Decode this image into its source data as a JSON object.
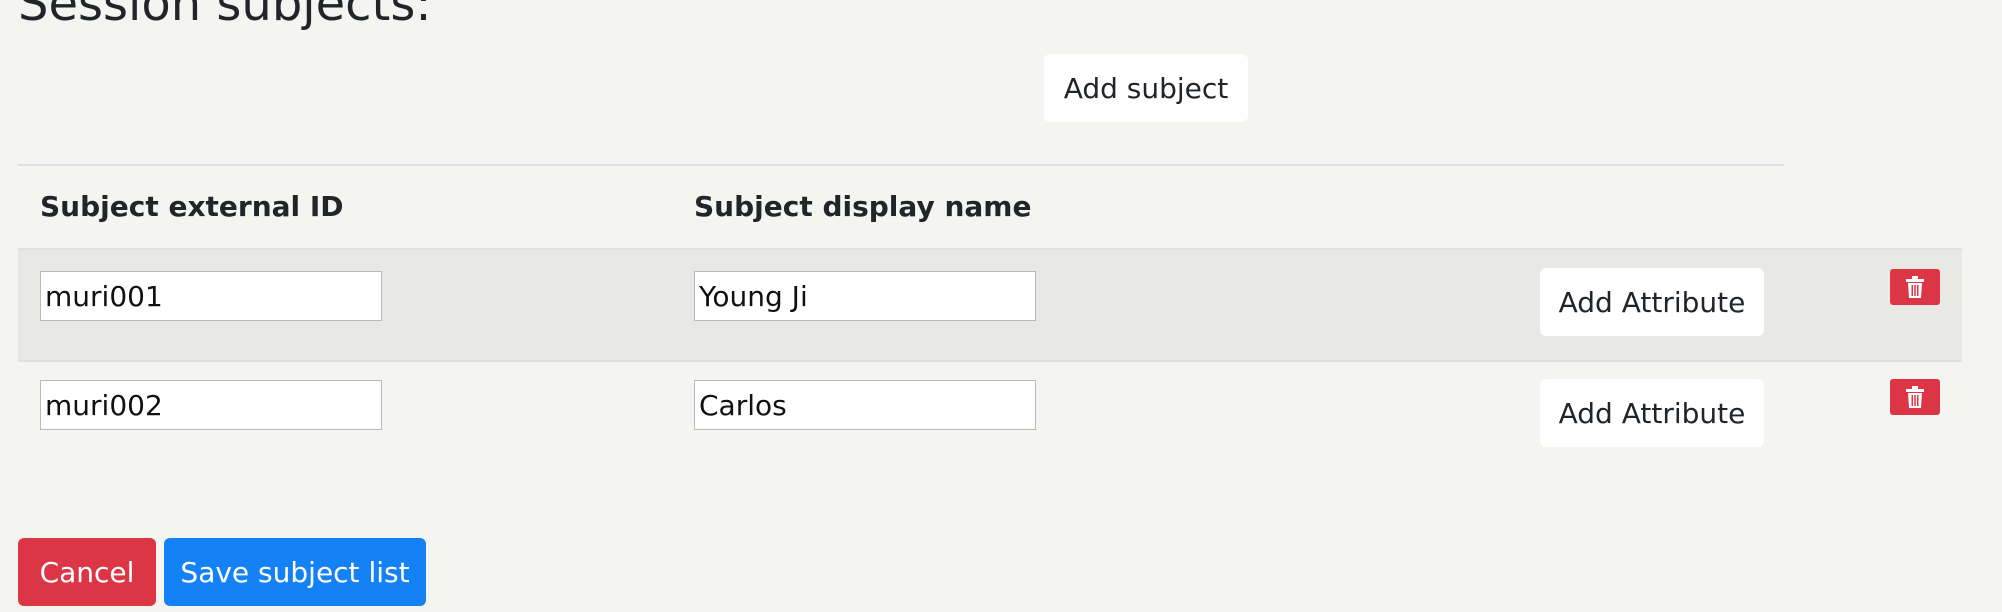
{
  "page": {
    "title": "Session subjects:"
  },
  "toolbar": {
    "add_subject_label": "Add subject"
  },
  "table": {
    "columns": [
      "Subject external ID",
      "Subject display name"
    ],
    "rows": [
      {
        "external_id": "muri001",
        "display_name": "Young Ji",
        "add_attribute_label": "Add Attribute",
        "delete_icon": "trash-icon"
      },
      {
        "external_id": "muri002",
        "display_name": "Carlos",
        "add_attribute_label": "Add Attribute",
        "delete_icon": "trash-icon"
      }
    ]
  },
  "footer": {
    "cancel_label": "Cancel",
    "save_label": "Save subject list"
  },
  "colors": {
    "background": "#f4f4f0",
    "danger": "#dc3545",
    "primary": "#1481f7",
    "light_button": "#ffffff",
    "striped_row": "#e8e8e4"
  }
}
